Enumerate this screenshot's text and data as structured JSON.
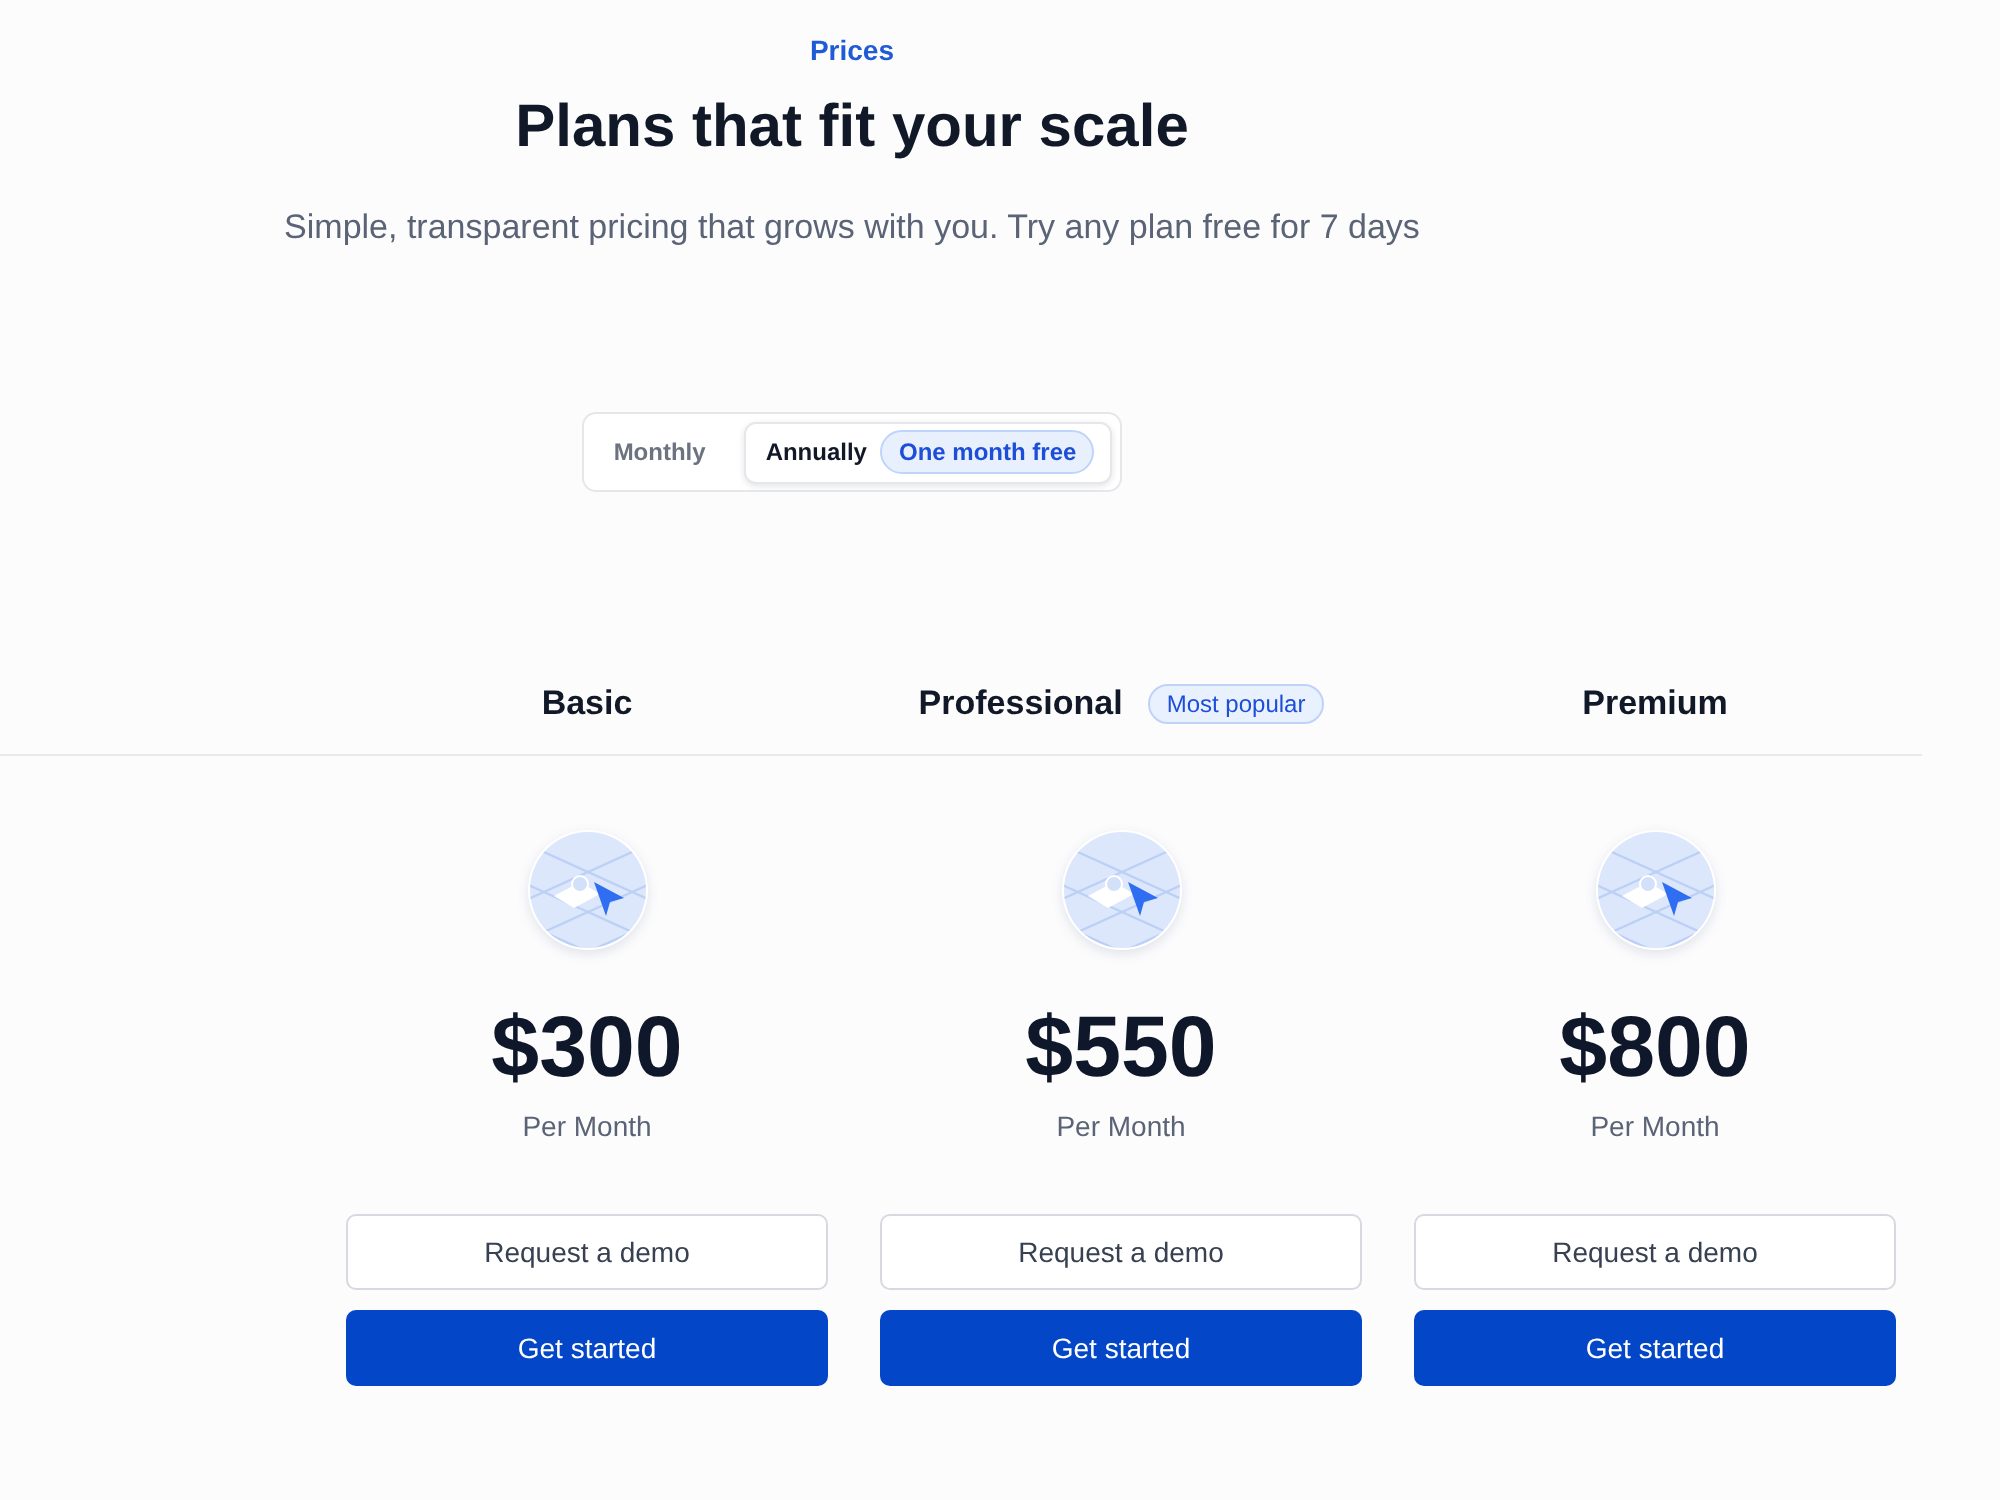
{
  "eyebrow": "Prices",
  "title": "Plans that fit your scale",
  "subtitle": "Simple, transparent pricing that grows with you. Try any plan free for 7 days",
  "billing_toggle": {
    "options": [
      {
        "label": "Monthly",
        "selected": false
      },
      {
        "label": "Annually",
        "selected": true,
        "badge": "One month free"
      }
    ]
  },
  "plans": [
    {
      "name": "Basic",
      "price": "$300",
      "period": "Per Month",
      "buttons": [
        {
          "label": "Request a demo",
          "kind": "secondary"
        },
        {
          "label": "Get started",
          "kind": "primary"
        }
      ]
    },
    {
      "name": "Professional",
      "badge": "Most popular",
      "price": "$550",
      "period": "Per Month",
      "buttons": [
        {
          "label": "Request a demo",
          "kind": "secondary"
        },
        {
          "label": "Get started",
          "kind": "primary"
        }
      ]
    },
    {
      "name": "Premium",
      "price": "$800",
      "period": "Per Month",
      "buttons": [
        {
          "label": "Request a demo",
          "kind": "secondary"
        },
        {
          "label": "Get started",
          "kind": "primary"
        }
      ]
    }
  ]
}
